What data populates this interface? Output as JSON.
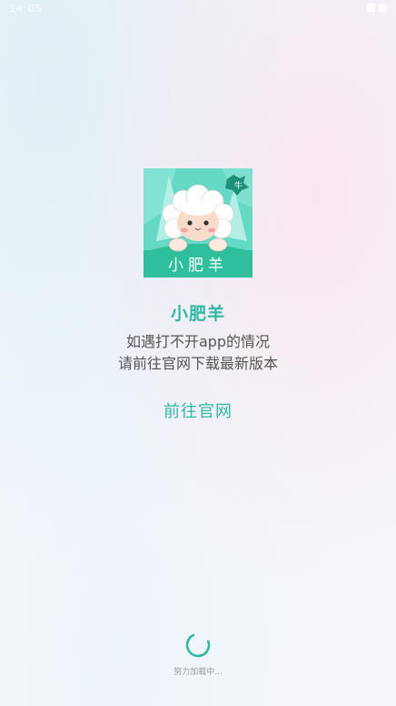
{
  "app": {
    "name": "小肥羊",
    "logo_text": "小肥羊"
  },
  "status_bar": {
    "time": "14:05",
    "icons": [
      "wifi-icon",
      "battery-icon"
    ]
  },
  "notice": {
    "line1": "如遇打不开app的情况",
    "line2": "请前往官网下载最新版本"
  },
  "link": {
    "label": "前往官网"
  },
  "loading": {
    "text": "努力加载中...",
    "icon": "spinner-icon"
  },
  "colors": {
    "accent": "#2fb8a4",
    "logo_bg": "#5fd6c3",
    "text_secondary": "#555555"
  }
}
